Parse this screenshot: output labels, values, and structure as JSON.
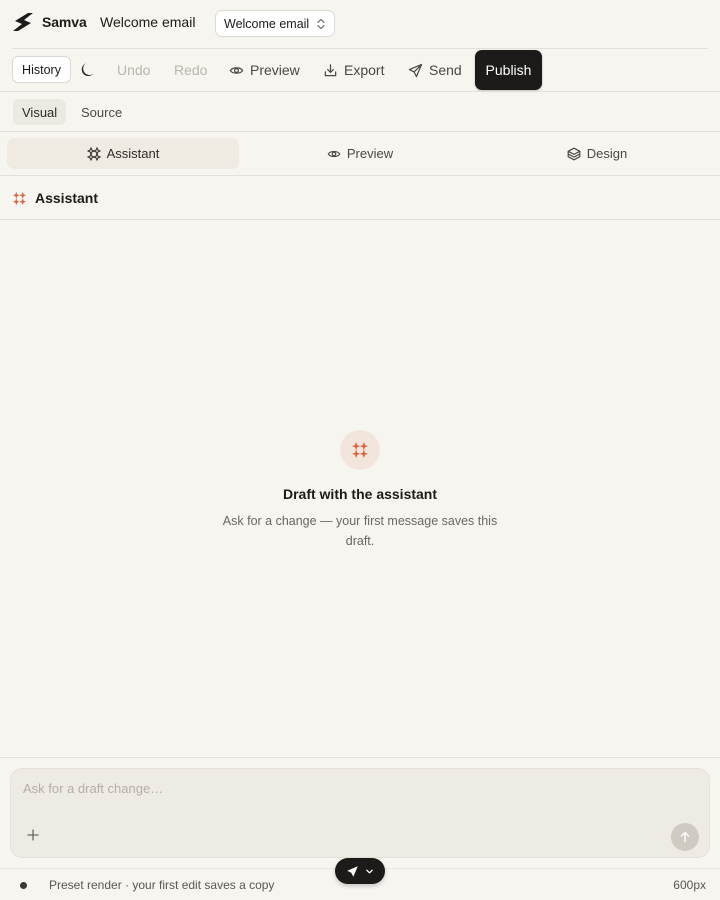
{
  "app": {
    "brand": "Samva",
    "document_title": "Welcome email",
    "template_select": "Welcome email"
  },
  "toolbar": {
    "history_label": "History",
    "undo_label": "Undo",
    "redo_label": "Redo",
    "preview_label": "Preview",
    "export_label": "Export",
    "send_label": "Send",
    "publish_label": "Publish"
  },
  "modes": {
    "visual_label": "Visual",
    "source_label": "Source"
  },
  "panel_tabs": {
    "assistant_label": "Assistant",
    "preview_label": "Preview",
    "design_label": "Design"
  },
  "panel": {
    "title": "Assistant",
    "empty_title": "Draft with the assistant",
    "empty_body": "Ask for a change — your first message saves this draft."
  },
  "composer": {
    "placeholder": "Ask for a draft change…",
    "value": ""
  },
  "footer": {
    "status_text": "Preset render · your first edit saves a copy",
    "width_value": "600px"
  },
  "colors": {
    "background": "#f7f5f0",
    "primary_button": "#1c1b19",
    "accent": "#d4684a",
    "accent_soft": "#f2e6dc"
  },
  "icons": {
    "logo": "samva-logo-icon",
    "theme": "moon-icon",
    "preview": "eye-icon",
    "export": "export-icon",
    "send": "paper-plane-icon",
    "assistant": "sparkle-icon",
    "design": "layers-icon",
    "select": "chevron-updown-icon",
    "attach": "plus-icon",
    "submit": "arrow-up-icon",
    "float_menu": "paper-plane-icon"
  }
}
